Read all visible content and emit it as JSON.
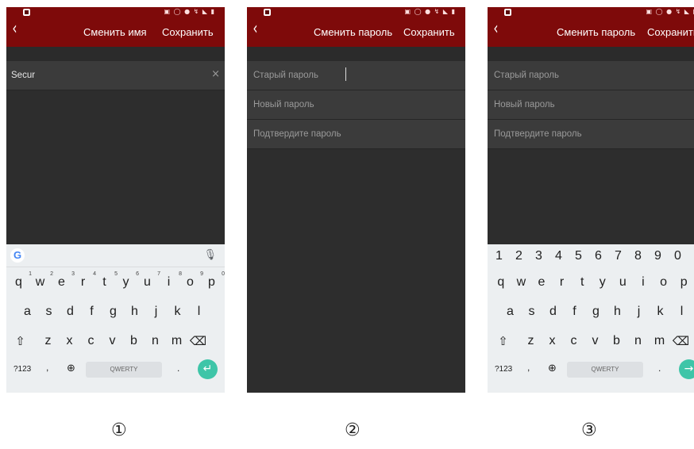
{
  "screens": [
    {
      "status_icons": "▣ ◯ ● ↯ ◣ ▮",
      "back_glyph": "‹",
      "title": "Сменить имя",
      "save_label": "Сохранить",
      "name_field": {
        "value": "Secur",
        "clear_icon": "×"
      },
      "keyboard": {
        "mic_icon": "🎙",
        "row1": [
          "q",
          "w",
          "e",
          "r",
          "t",
          "y",
          "u",
          "i",
          "o",
          "p"
        ],
        "row1_sup": [
          "1",
          "2",
          "3",
          "4",
          "5",
          "6",
          "7",
          "8",
          "9",
          "0"
        ],
        "row2": [
          "a",
          "s",
          "d",
          "f",
          "g",
          "h",
          "j",
          "k",
          "l"
        ],
        "row3": [
          "z",
          "x",
          "c",
          "v",
          "b",
          "n",
          "m"
        ],
        "symbols_label": "?123",
        "comma_label": ",",
        "globe_icon": "⊕",
        "space_label": "QWERTY",
        "dot_label": ".",
        "enter_icon": "↵"
      },
      "caption": "①"
    },
    {
      "status_icons": "▣ ◯ ● ↯ ◣ ▮",
      "back_glyph": "‹",
      "title": "Сменить пароль",
      "save_label": "Сохранить",
      "fields": [
        {
          "placeholder": "Старый пароль"
        },
        {
          "placeholder": "Новый пароль"
        },
        {
          "placeholder": "Подтвердите пароль"
        }
      ],
      "caption": "②"
    },
    {
      "status_icons": "▣ ◯ ● ↯ ◣ ▮",
      "back_glyph": "‹",
      "title": "Сменить пароль",
      "save_label": "Сохранить",
      "fields": [
        {
          "placeholder": "Старый пароль"
        },
        {
          "placeholder": "Новый пароль"
        },
        {
          "placeholder": "Подтвердите пароль"
        }
      ],
      "keyboard": {
        "numbers": [
          "1",
          "2",
          "3",
          "4",
          "5",
          "6",
          "7",
          "8",
          "9",
          "0"
        ],
        "row1": [
          "q",
          "w",
          "e",
          "r",
          "t",
          "y",
          "u",
          "i",
          "o",
          "p"
        ],
        "row2": [
          "a",
          "s",
          "d",
          "f",
          "g",
          "h",
          "j",
          "k",
          "l"
        ],
        "row3": [
          "z",
          "x",
          "c",
          "v",
          "b",
          "n",
          "m"
        ],
        "symbols_label": "?123",
        "comma_label": ",",
        "globe_icon": "⊕",
        "space_label": "QWERTY",
        "dot_label": ".",
        "next_icon": "→"
      },
      "caption": "③"
    }
  ],
  "colors": {
    "header": "#7e0a0a",
    "background": "#2d2d2d",
    "field": "#3b3b3b",
    "enter_key": "#3ec5a8"
  }
}
